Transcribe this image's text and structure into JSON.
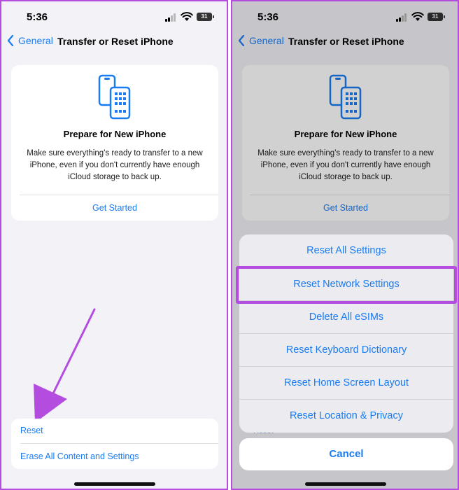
{
  "status": {
    "time": "5:36",
    "battery": "31"
  },
  "nav": {
    "back_label": "General",
    "title": "Transfer or Reset iPhone"
  },
  "prepare_card": {
    "title": "Prepare for New iPhone",
    "description": "Make sure everything's ready to transfer to a new iPhone, even if you don't currently have enough iCloud storage to back up.",
    "action": "Get Started"
  },
  "reset_group": {
    "reset_label": "Reset",
    "erase_label": "Erase All Content and Settings"
  },
  "action_sheet": {
    "items": [
      "Reset All Settings",
      "Reset Network Settings",
      "Delete All eSIMs",
      "Reset Keyboard Dictionary",
      "Reset Home Screen Layout",
      "Reset Location & Privacy"
    ],
    "cancel": "Cancel",
    "highlighted_item": "Reset Network Settings"
  },
  "colors": {
    "accent": "#1a7cf2",
    "annotation": "#b54ce0"
  }
}
